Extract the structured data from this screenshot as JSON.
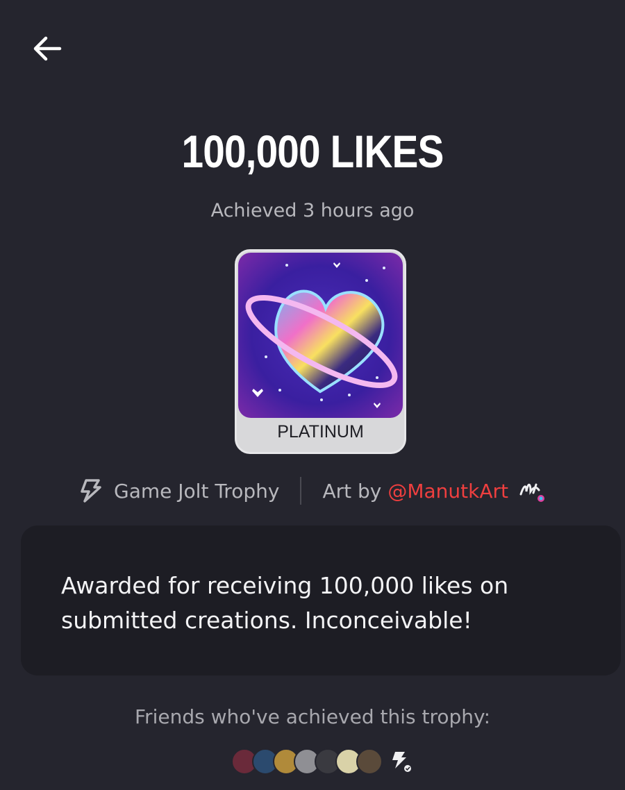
{
  "header": {
    "back_icon": "arrow-left-icon"
  },
  "trophy": {
    "title": "100,000 LIKES",
    "achieved": "Achieved 3 hours ago",
    "tier": "PLATINUM",
    "art_icon": "heart-planet-icon"
  },
  "meta": {
    "source_icon": "game-jolt-bolt-icon",
    "source_label": "Game Jolt Trophy",
    "art_prefix": "Art by",
    "artist": "@ManutkArt"
  },
  "description": "Awarded for receiving 100,000 likes on submitted creations. Inconceivable!",
  "friends": {
    "label": "Friends who've achieved this trophy:",
    "avatars": [
      {
        "color": "#6a2a3a"
      },
      {
        "color": "#2b4a6e"
      },
      {
        "color": "#b08a3a"
      },
      {
        "color": "#8f8f94"
      },
      {
        "color": "#3a3a40"
      },
      {
        "color": "#d9d2a8"
      },
      {
        "color": "#5a4a3a"
      }
    ]
  },
  "colors": {
    "background": "#25252e",
    "card": "#1d1d24",
    "accent": "#ef3f3f",
    "tier_bg": "#d8d8da"
  }
}
